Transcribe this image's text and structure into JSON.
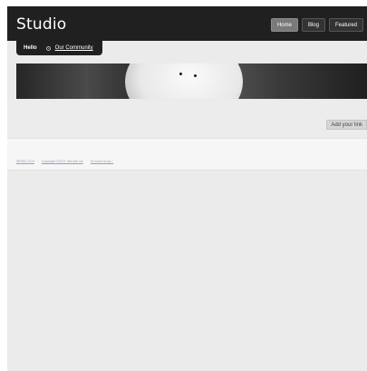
{
  "header": {
    "brand": "Studio",
    "nav": [
      {
        "label": "Home",
        "active": true
      },
      {
        "label": "Blog",
        "active": false
      },
      {
        "label": "Featured",
        "active": false
      }
    ]
  },
  "subnav": {
    "greeting": "Hello",
    "community_link": "Our Community"
  },
  "main": {
    "add_link_label": "Add your link"
  },
  "footer": {
    "links": [
      "WPMU 2013",
      "Copyright ©2013 Test site me",
      "Go back to top ↑"
    ]
  },
  "colors": {
    "topbar": "#202020",
    "page_background": "#ebebeb",
    "active_nav": "#7a7a7a"
  }
}
